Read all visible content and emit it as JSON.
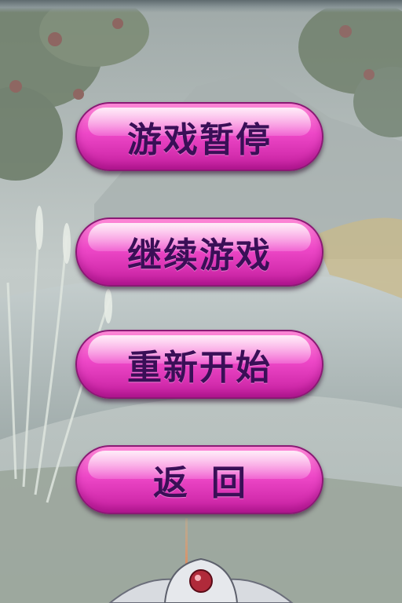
{
  "menu": {
    "buttons": [
      {
        "label": "游戏暂停"
      },
      {
        "label": "继续游戏"
      },
      {
        "label": "重新开始"
      },
      {
        "label": "返回"
      }
    ]
  },
  "colors": {
    "button_top": "#ff8ad8",
    "button_mid": "#ee48c8",
    "button_bottom": "#c51e9f",
    "label_text": "#3a0f57",
    "mist_background": "#b9c3c3"
  }
}
